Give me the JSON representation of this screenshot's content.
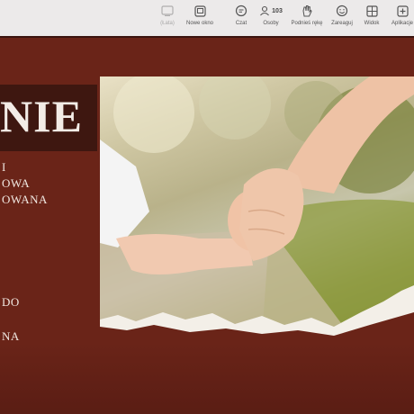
{
  "toolbar": {
    "items": [
      {
        "label": "(Łata)",
        "icon": "camera-icon"
      },
      {
        "label": "Nowe okno",
        "icon": "new-window-icon"
      },
      {
        "label": "Czat",
        "icon": "chat-icon"
      },
      {
        "label": "Osoby",
        "icon": "people-icon",
        "count": "103"
      },
      {
        "label": "Podnieś rękę",
        "icon": "raise-hand-icon"
      },
      {
        "label": "Zareaguj",
        "icon": "smiley-icon"
      },
      {
        "label": "Widok",
        "icon": "grid-view-icon"
      },
      {
        "label": "Aplikacje",
        "icon": "plus-icon"
      }
    ]
  },
  "slide": {
    "title": "NIE",
    "lines": [
      "I",
      "OWA",
      "OWANA",
      "DO",
      "NA"
    ],
    "photo_description_icon": "holding-hands-photo"
  },
  "colors": {
    "toolbar_bg": "#eceaea",
    "slide_bg": "#6a2418",
    "title_box": "#3e1710",
    "text": "#f3ece6"
  }
}
